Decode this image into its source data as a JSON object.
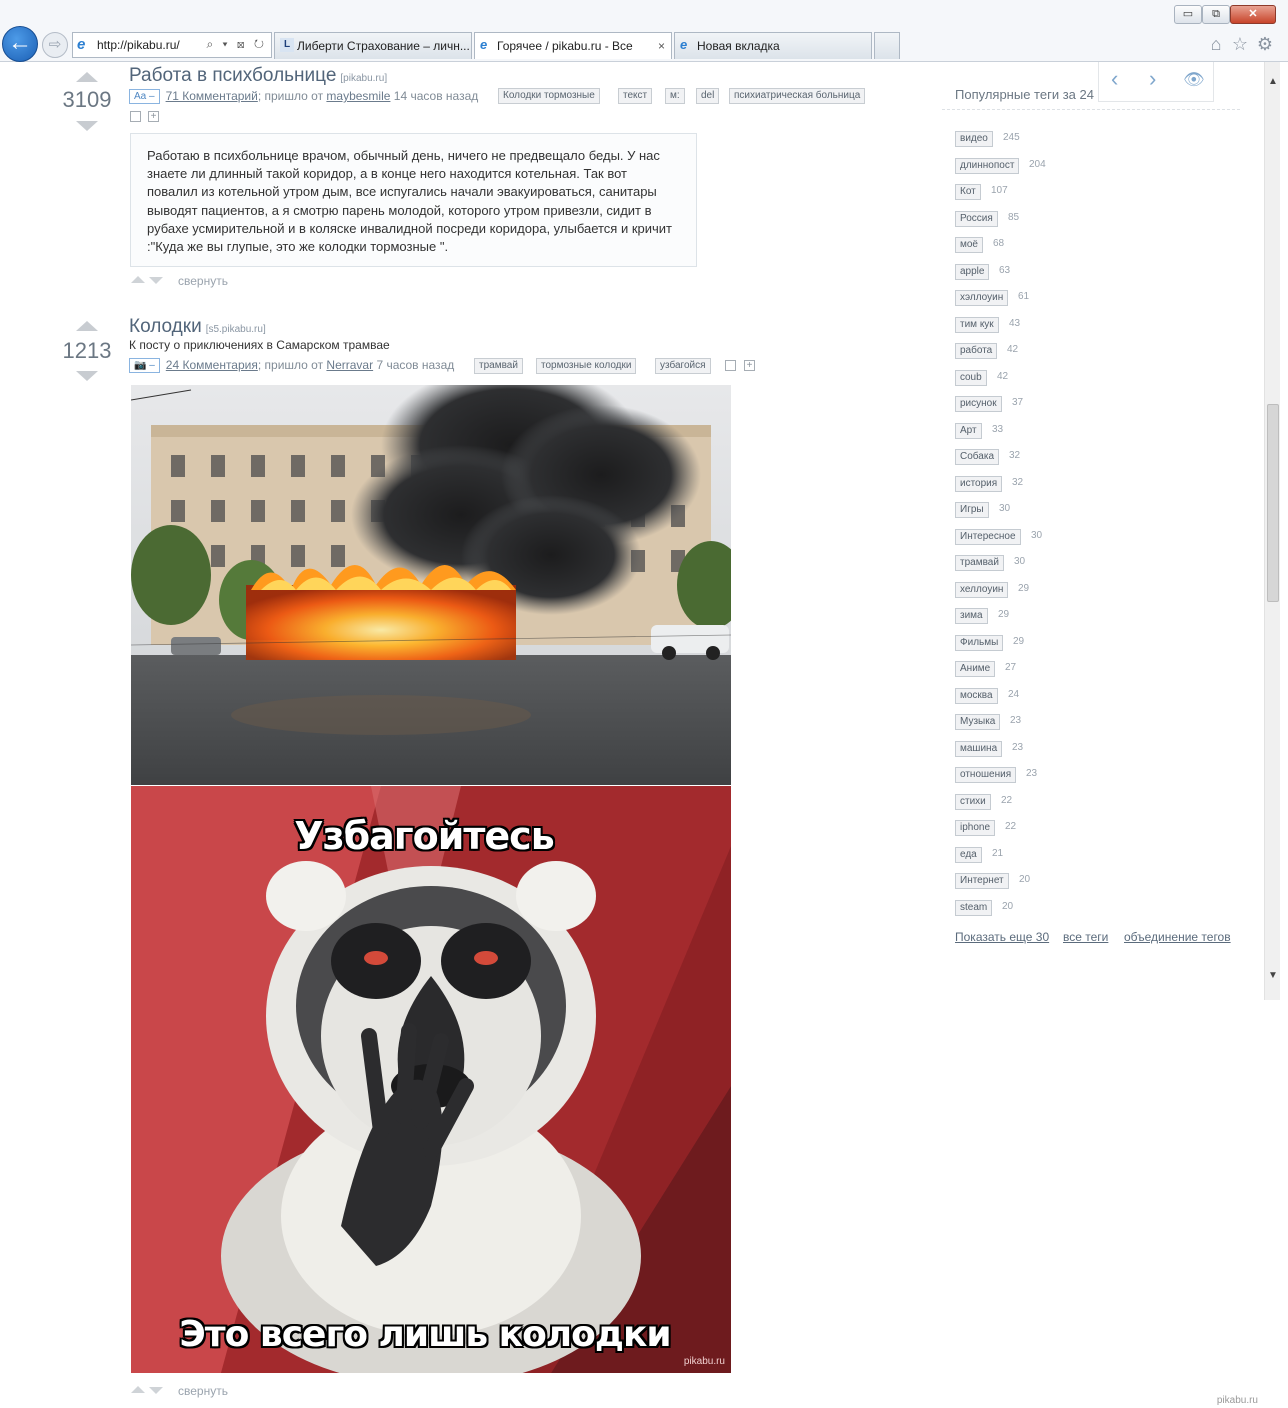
{
  "browser": {
    "url": "http://pikabu.ru/",
    "address_tools": "⌕ ▾ ⊠ ↻",
    "window_controls": {
      "minimize": "▭",
      "restore": "⧉",
      "close": "✕"
    },
    "tabs": [
      {
        "title": "Либерти Страхование – личн...",
        "icon": "liberty-icon",
        "active": false
      },
      {
        "title": "Горячее / pikabu.ru - Все",
        "icon": "ie-icon",
        "active": true,
        "close": "×"
      },
      {
        "title": "Новая вкладка",
        "icon": "ie-icon",
        "active": false
      }
    ],
    "command_icons": [
      "home-icon",
      "favorites-star-icon",
      "tools-gear-icon"
    ]
  },
  "posts": [
    {
      "rating": "3109",
      "title": "Работа в психбольнице",
      "domain": "[pikabu.ru]",
      "type_badge": "Aa –",
      "comments": "71 Комментарий",
      "meta_mid": "; пришло от ",
      "author": "maybesmile",
      "time": " 14 часов назад",
      "tags": [
        "Колодки тормозные",
        "текст",
        "м:",
        "del",
        "психиатрическая больница"
      ],
      "text": "Работаю в психбольнице врачом, обычный день, ничего не предвещало беды. У нас знаете ли длинный такой коридор, а в конце него находится котельная. Так вот повалил из котельной утром дым, все испугались начали эвакуироваться, санитары выводят пациентов, а я смотрю парень молодой, которого утром привезли, сидит в рубахе усмирительной и в коляске инвалидной посреди коридора, улыбается и кричит :\"Куда же вы глупые, это же колодки тормозные \".",
      "collapse": "свернуть"
    },
    {
      "rating": "1213",
      "title": "Колодки",
      "domain": "[s5.pikabu.ru]",
      "subtitle": "К посту о приключениях в Самарском трамвае",
      "type_badge": "📷 –",
      "comments": "24 Комментария",
      "meta_mid": "; пришло от ",
      "author": "Nerravar",
      "time": " 7 часов назад",
      "tags": [
        "трамвай",
        "тормозные колодки",
        "узбагойся"
      ],
      "meme_top": "Узбагойтесь",
      "meme_bottom": "Это всего лишь колодки",
      "meme_watermark": "pikabu.ru",
      "collapse": "свернуть"
    }
  ],
  "sidebar": {
    "title": "Популярные теги за 24",
    "nav_icons": [
      "arrow-left-icon",
      "arrow-right-icon",
      "eye-hide-icon"
    ],
    "tags": [
      {
        "name": "видео",
        "count": "245"
      },
      {
        "name": "длиннопост",
        "count": "204"
      },
      {
        "name": "Кот",
        "count": "107"
      },
      {
        "name": "Россия",
        "count": "85"
      },
      {
        "name": "моё",
        "count": "68"
      },
      {
        "name": "apple",
        "count": "63"
      },
      {
        "name": "хэллоуин",
        "count": "61"
      },
      {
        "name": "тим кук",
        "count": "43"
      },
      {
        "name": "работа",
        "count": "42"
      },
      {
        "name": "coub",
        "count": "42"
      },
      {
        "name": "рисунок",
        "count": "37"
      },
      {
        "name": "Арт",
        "count": "33"
      },
      {
        "name": "Собака",
        "count": "32"
      },
      {
        "name": "история",
        "count": "32"
      },
      {
        "name": "Игры",
        "count": "30"
      },
      {
        "name": "Интересное",
        "count": "30"
      },
      {
        "name": "трамвай",
        "count": "30"
      },
      {
        "name": "хеллоуин",
        "count": "29"
      },
      {
        "name": "зима",
        "count": "29"
      },
      {
        "name": "Фильмы",
        "count": "29"
      },
      {
        "name": "Аниме",
        "count": "27"
      },
      {
        "name": "москва",
        "count": "24"
      },
      {
        "name": "Музыка",
        "count": "23"
      },
      {
        "name": "машина",
        "count": "23"
      },
      {
        "name": "отношения",
        "count": "23"
      },
      {
        "name": "стихи",
        "count": "22"
      },
      {
        "name": "iphone",
        "count": "22"
      },
      {
        "name": "еда",
        "count": "21"
      },
      {
        "name": "Интернет",
        "count": "20"
      },
      {
        "name": "steam",
        "count": "20"
      }
    ],
    "links": {
      "more": "Показать еще 30",
      "all": "все теги",
      "merge": "объединение тегов"
    }
  },
  "page_watermark": "pikabu.ru",
  "colors": {
    "accent": "#52657a",
    "link": "#6b7b8c",
    "badge_blue": "#4f87c2",
    "ie_blue": "#1b5fb4"
  }
}
